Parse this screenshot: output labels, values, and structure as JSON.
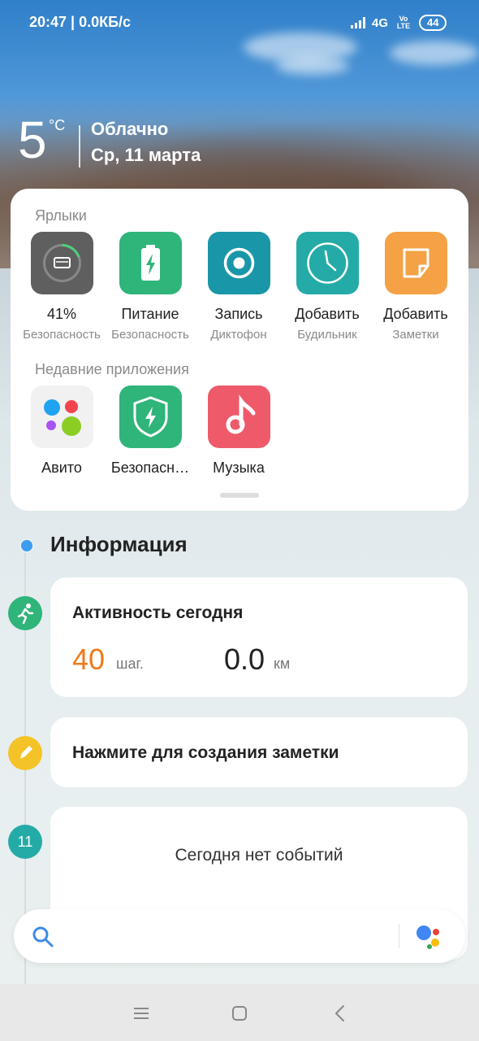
{
  "status_bar": {
    "time_speed": "20:47 | 0.0КБ/с",
    "network": "4G",
    "volte": "Vo LTE",
    "battery": "44"
  },
  "weather": {
    "temperature": "5",
    "unit": "°C",
    "condition": "Облачно",
    "date": "Ср, 11 марта"
  },
  "shortcuts": {
    "title": "Ярлыки",
    "items": [
      {
        "label": "41%",
        "sublabel": "Безопасность",
        "icon": "cleaner-icon",
        "color": "#5f5f5f"
      },
      {
        "label": "Питание",
        "sublabel": "Безопасность",
        "icon": "battery-icon",
        "color": "#2fb47a"
      },
      {
        "label": "Запись",
        "sublabel": "Диктофон",
        "icon": "record-icon",
        "color": "#1996a8"
      },
      {
        "label": "Добавить",
        "sublabel": "Будильник",
        "icon": "clock-icon",
        "color": "#25aba7"
      },
      {
        "label": "Добавить",
        "sublabel": "Заметки",
        "icon": "note-icon",
        "color": "#f4a245"
      }
    ]
  },
  "recent_apps": {
    "title": "Недавние приложения",
    "items": [
      {
        "label": "Авито",
        "icon": "avito-icon",
        "color": "#f1f1f1"
      },
      {
        "label": "Безопасн…",
        "icon": "security-shield-icon",
        "color": "#2fb47a"
      },
      {
        "label": "Музыка",
        "icon": "music-icon",
        "color": "#ee5a6a"
      }
    ]
  },
  "information": {
    "title": "Информация",
    "activity": {
      "title": "Активность сегодня",
      "steps": "40",
      "steps_unit": "шаг.",
      "distance": "0.0",
      "distance_unit": "км"
    },
    "note": {
      "title": "Нажмите для создания заметки"
    },
    "calendar": {
      "day": "11",
      "text": "Сегодня нет событий"
    }
  },
  "colors": {
    "steps": "#f07a1a",
    "dot": "#3c9cf0",
    "activity_icon": "#2fb47a",
    "note_icon": "#f4c328",
    "calendar_icon": "#25aba7"
  }
}
